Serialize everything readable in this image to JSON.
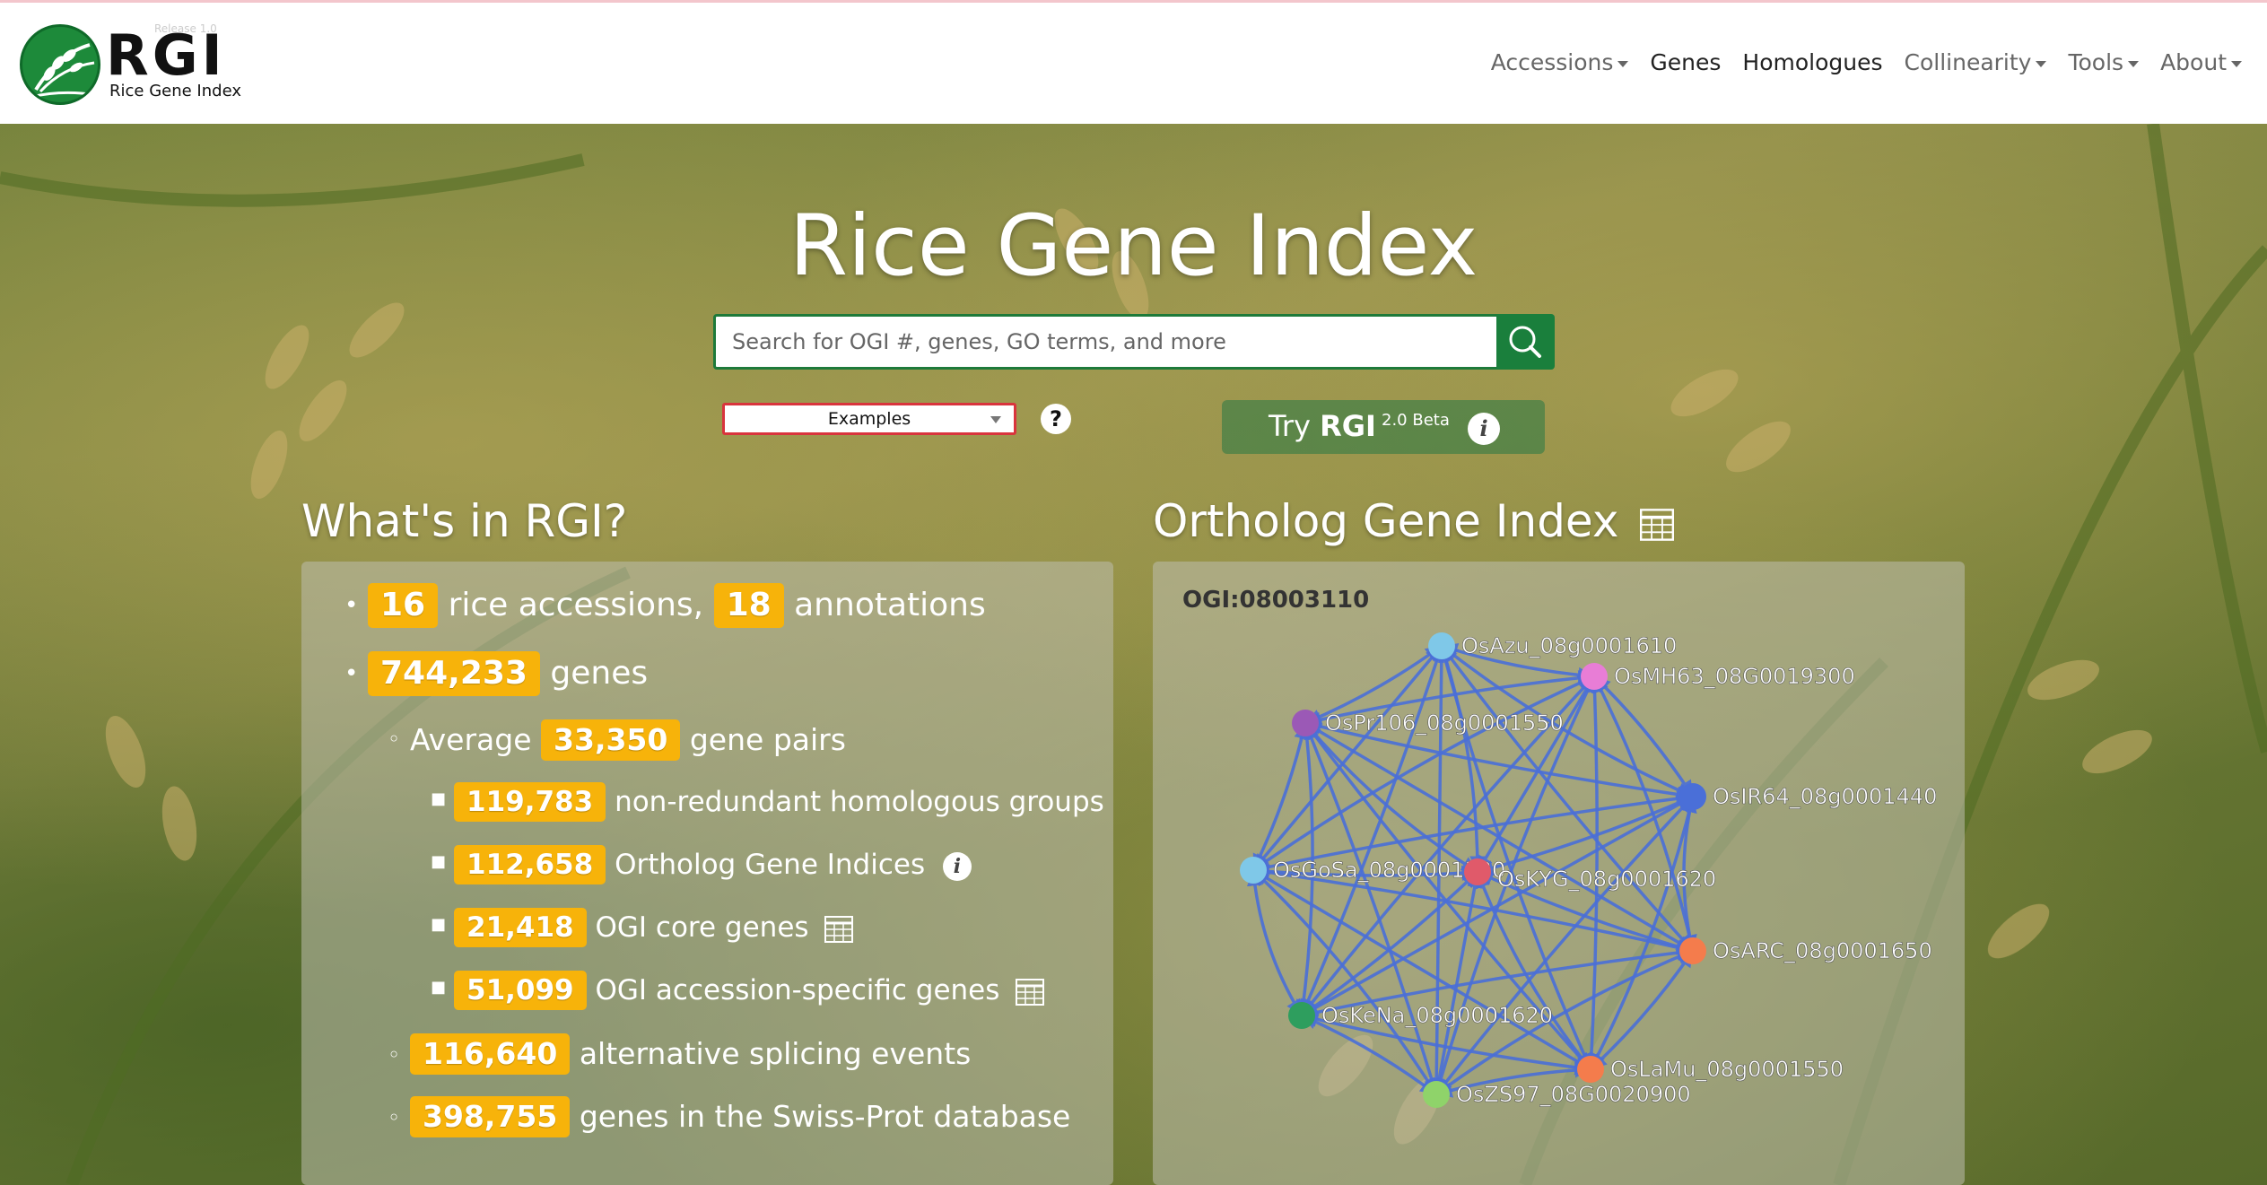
{
  "nav": {
    "logo_text": "RGI",
    "logo_sub": "Rice Gene Index",
    "logo_version": "Release 1.0",
    "items": [
      {
        "label": "Accessions",
        "dropdown": true
      },
      {
        "label": "Genes",
        "dropdown": false
      },
      {
        "label": "Homologues",
        "dropdown": false
      },
      {
        "label": "Collinearity",
        "dropdown": true
      },
      {
        "label": "Tools",
        "dropdown": true
      },
      {
        "label": "About",
        "dropdown": true
      }
    ]
  },
  "hero": {
    "title": "Rice Gene Index",
    "search_placeholder": "Search for OGI #, genes, GO terms, and more",
    "examples_label": "Examples",
    "help_label": "?",
    "try_label": "Try",
    "try_brand": "RGI",
    "try_version": "2.0 Beta",
    "info_label": "i"
  },
  "whats_in": {
    "title": "What's in RGI?",
    "accessions_count": "16",
    "accessions_text": "rice accessions,",
    "annotations_count": "18",
    "annotations_text": "annotations",
    "genes_count": "744,233",
    "genes_text": "genes",
    "avg_label": "Average",
    "avg_count": "33,350",
    "avg_text": "gene pairs",
    "nr_count": "119,783",
    "nr_text": "non-redundant homologous groups",
    "ogi_count": "112,658",
    "ogi_text": "Ortholog Gene Indices",
    "core_count": "21,418",
    "core_text": "OGI core genes",
    "spec_count": "51,099",
    "spec_text": "OGI accession-specific genes",
    "as_count": "116,640",
    "as_text": "alternative splicing events",
    "sp_count": "398,755",
    "sp_text": "genes in the Swiss-Prot database"
  },
  "ogi": {
    "title": "Ortholog Gene Index",
    "id": "OGI:08003110",
    "edge_color": "#4a6fd8",
    "nodes": [
      {
        "label": "OsAzu_08g0001610",
        "color": "#7fc8e8"
      },
      {
        "label": "OsMH63_08G0019300",
        "color": "#e87dd6"
      },
      {
        "label": "OsPr106_08g0001550",
        "color": "#9b59b6"
      },
      {
        "label": "OsIR64_08g0001440",
        "color": "#4a6fd8"
      },
      {
        "label": "OsGoSa_08g0001530",
        "color": "#7fc8e8"
      },
      {
        "label": "OsKYG_08g0001620",
        "color": "#e05a6a"
      },
      {
        "label": "OsARC_08g0001650",
        "color": "#f47c4c"
      },
      {
        "label": "OsKeNa_08g0001620",
        "color": "#2e9e5e"
      },
      {
        "label": "OsLaMu_08g0001550",
        "color": "#f47c4c"
      },
      {
        "label": "OsZS97_08G0020900",
        "color": "#8fd36a"
      }
    ]
  }
}
